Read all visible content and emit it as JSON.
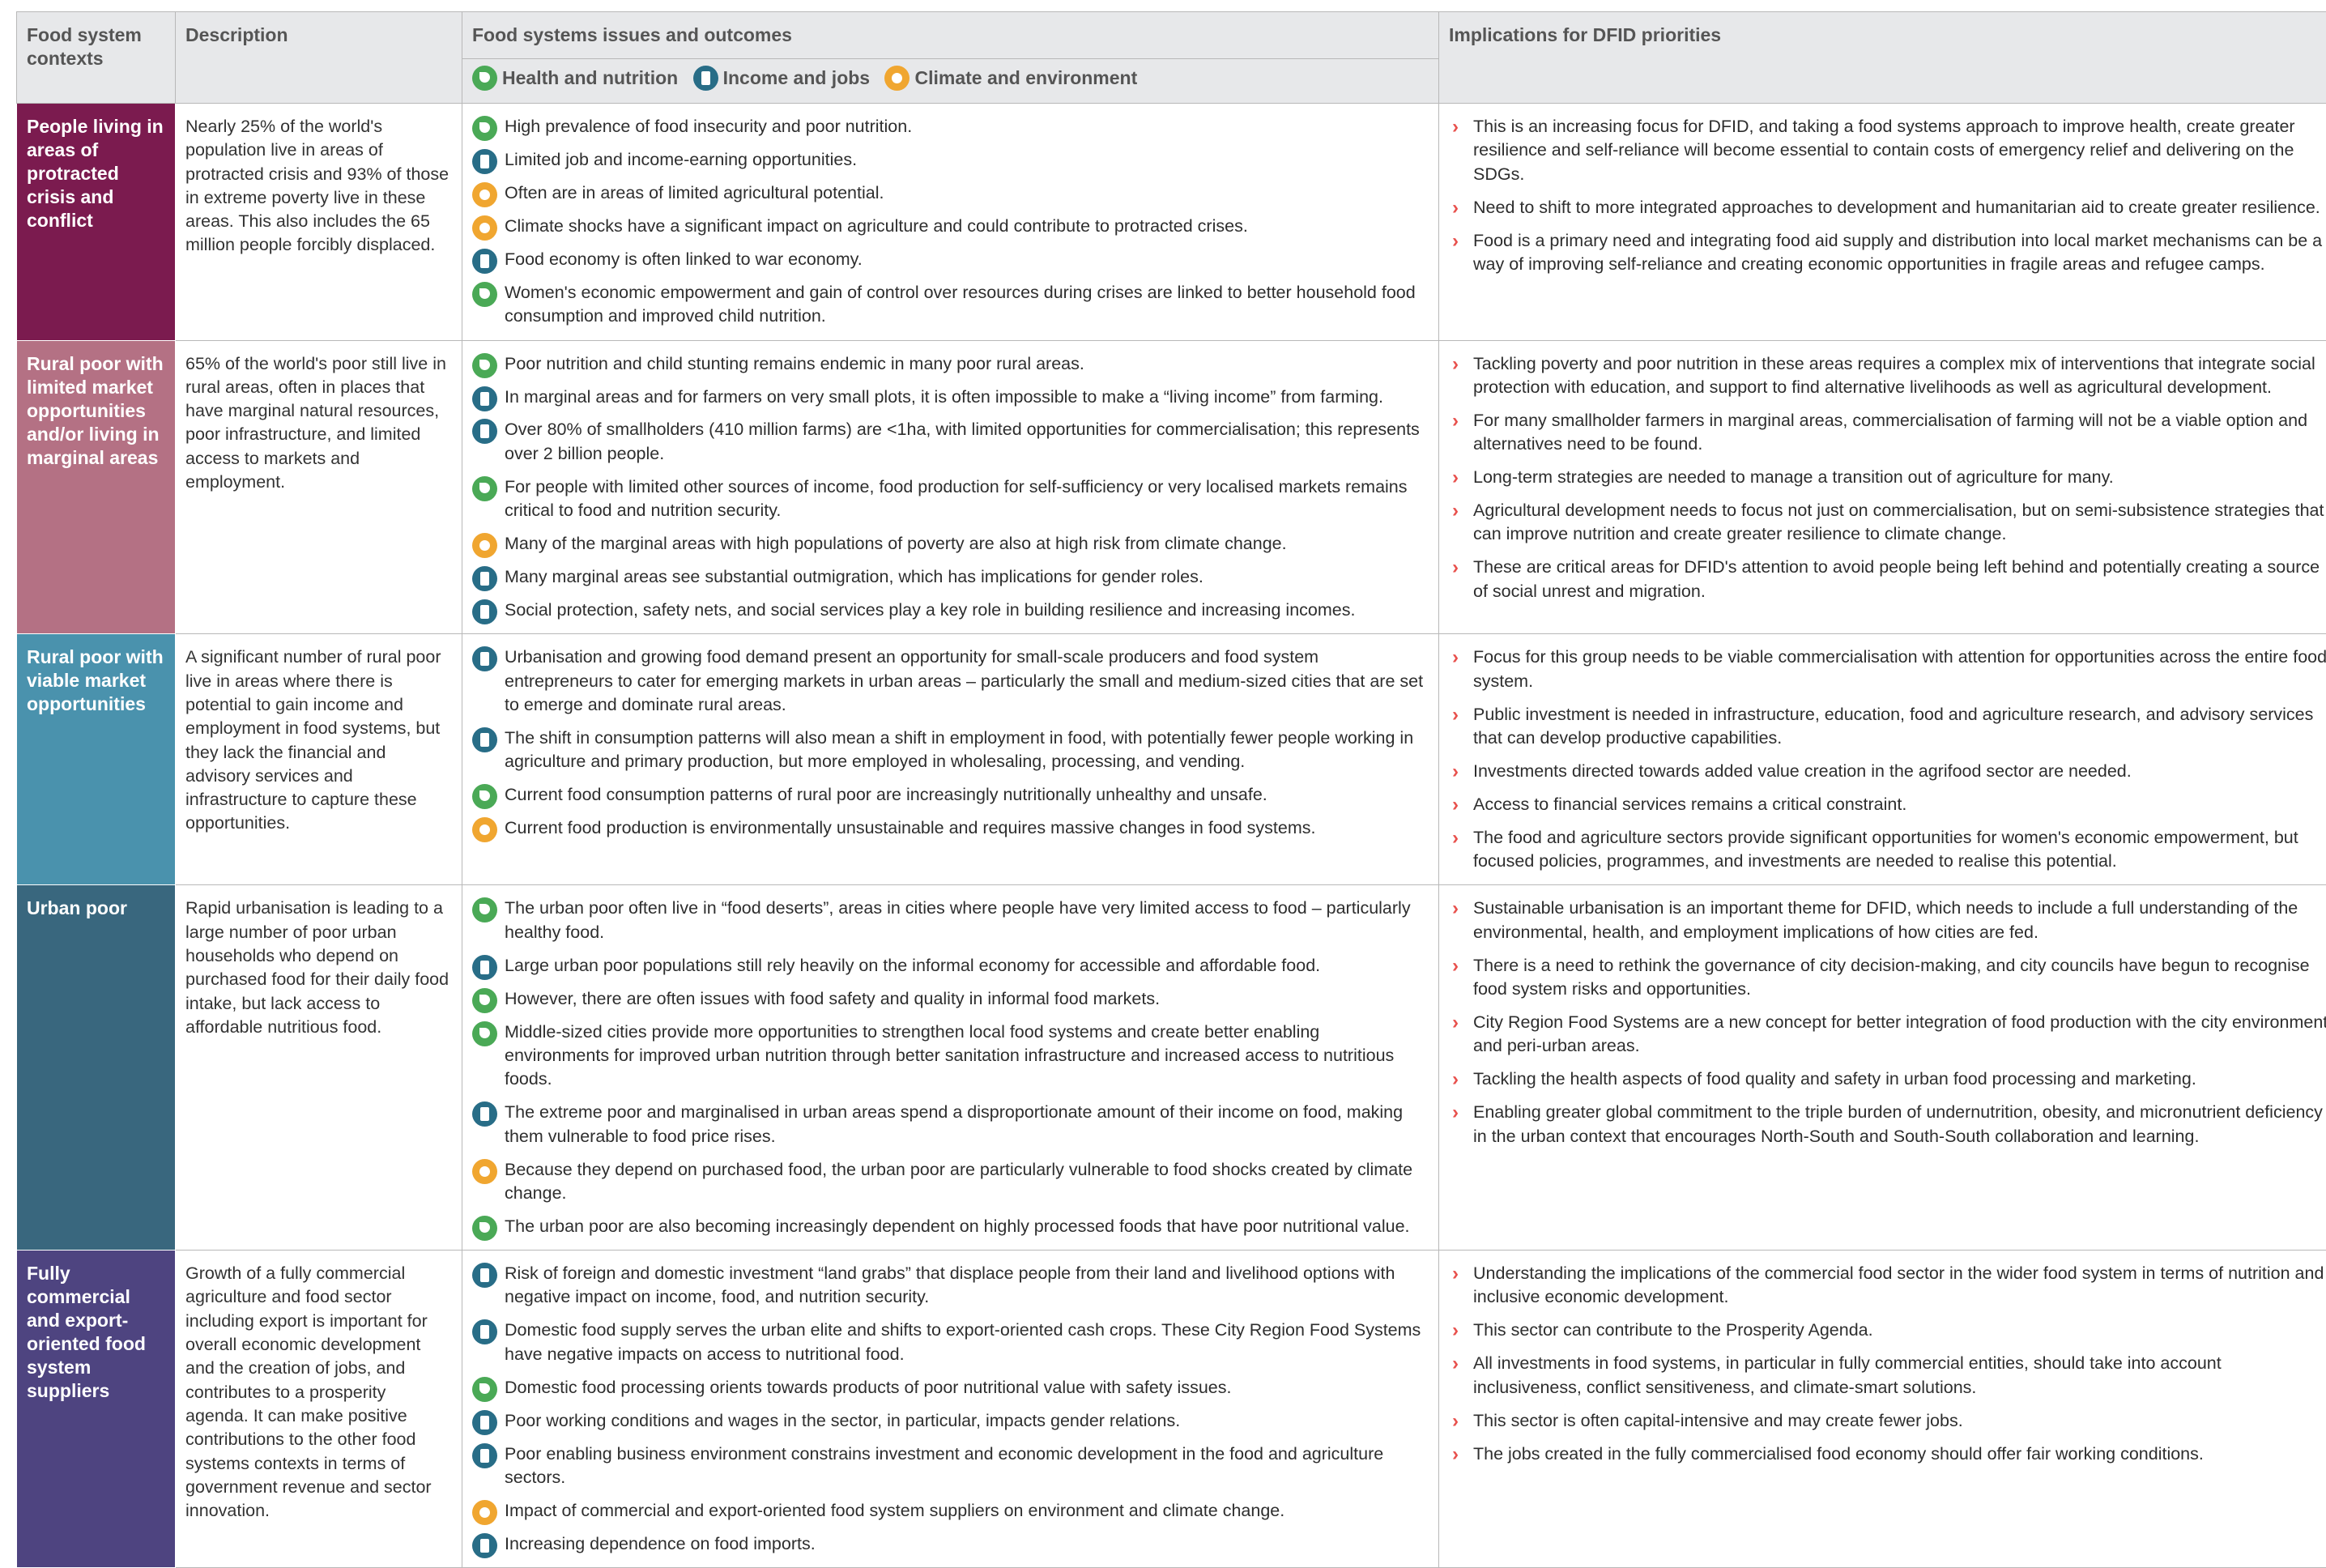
{
  "header": {
    "col1": "Food system contexts",
    "col2": "Description",
    "col3": "Food systems issues and outcomes",
    "col4": "Implications for DFID priorities",
    "legend": [
      {
        "icon": "health-icon",
        "label": "Health and nutrition"
      },
      {
        "icon": "income-icon",
        "label": "Income and jobs"
      },
      {
        "icon": "climate-icon",
        "label": "Climate and environment"
      }
    ]
  },
  "colors": {
    "health": "#4aa956",
    "income": "#286d87",
    "climate": "#f0a630",
    "chevron": "#e8514d",
    "row1": "#7b1b4f",
    "row2": "#b47184",
    "row3": "#4a92ad",
    "row4": "#39677e",
    "row5": "#4e4480"
  },
  "rows": [
    {
      "context": "People living in areas of protracted crisis and conflict",
      "description": "Nearly 25% of the world's population live in areas of protracted crisis and 93% of those in extreme poverty live in these areas. This also includes the 65 million people forcibly displaced.",
      "issues": [
        {
          "icon": "health",
          "text": "High prevalence of food insecurity and poor nutrition."
        },
        {
          "icon": "income",
          "text": "Limited job and income-earning opportunities."
        },
        {
          "icon": "climate",
          "text": "Often are in areas of limited agricultural potential."
        },
        {
          "icon": "climate",
          "text": "Climate shocks have a significant impact on agriculture and could contribute to protracted crises."
        },
        {
          "icon": "income",
          "text": "Food economy is often linked to war economy."
        },
        {
          "icon": "health",
          "text": "Women's economic empowerment and gain of control over resources during crises are linked to better household food consumption and improved child nutrition."
        }
      ],
      "implications": [
        "This is an increasing focus for DFID, and taking a food systems approach to improve health, create greater resilience and self-reliance will become essential to contain costs of emergency relief and delivering on the SDGs.",
        "Need to shift to more integrated approaches to development and humanitarian aid to create greater resilience.",
        "Food is a primary need and integrating food aid supply and distribution into local market mechanisms can be a way of improving self-reliance and creating economic opportunities in fragile areas and refugee camps."
      ]
    },
    {
      "context": "Rural poor with limited market opportunities and/or living in marginal areas",
      "description": "65% of the world's poor still live in rural areas, often in places that have marginal natural resources, poor infrastructure, and limited access to markets and employment.",
      "issues": [
        {
          "icon": "health",
          "text": "Poor nutrition and child stunting remains endemic in many poor rural areas."
        },
        {
          "icon": "income",
          "text": "In marginal areas and for farmers on very small plots, it is often impossible to make a “living income” from farming."
        },
        {
          "icon": "income",
          "text": "Over 80% of smallholders (410 million farms) are <1ha, with limited opportunities for commercialisation; this represents over 2 billion people."
        },
        {
          "icon": "health",
          "text": "For people with limited other sources of income, food production for self-sufficiency or very localised markets remains critical to food and nutrition security."
        },
        {
          "icon": "climate",
          "text": "Many of the marginal areas with high populations of poverty are also at high risk from climate change."
        },
        {
          "icon": "income",
          "text": "Many marginal areas see substantial outmigration, which has implications for gender roles."
        },
        {
          "icon": "income",
          "text": "Social protection, safety nets, and social services play a key role in building resilience and increasing incomes."
        }
      ],
      "implications": [
        "Tackling poverty and poor nutrition in these areas requires a complex mix of interventions that integrate social protection with education, and support to find alternative livelihoods as well as agricultural development.",
        "For many smallholder farmers in marginal areas, commercialisation of farming will not be a viable option and alternatives need to be found.",
        "Long-term strategies are needed to manage a transition out of agriculture for many.",
        "Agricultural development needs to focus not just on commercialisation, but on semi-subsistence strategies that can improve nutrition and create greater resilience to climate change.",
        "These are critical areas for DFID's attention to avoid people being left behind and potentially creating a source of social unrest and migration."
      ]
    },
    {
      "context": "Rural poor with viable market opportunities",
      "description": "A significant number of rural poor live in areas where there is potential to gain income and employment in food systems, but they lack the financial and advisory services and infrastructure to capture these opportunities.",
      "issues": [
        {
          "icon": "income",
          "text": "Urbanisation and growing food demand present an opportunity for small-scale producers and food system entrepreneurs to cater for emerging markets in urban areas – particularly the small and medium-sized cities that are set to emerge and dominate rural areas."
        },
        {
          "icon": "income",
          "text": "The shift in consumption patterns will also mean a shift in employment in food, with potentially fewer people working in agriculture and primary production, but more employed in wholesaling, processing, and vending."
        },
        {
          "icon": "health",
          "text": "Current food consumption patterns of rural poor are increasingly nutritionally unhealthy and unsafe."
        },
        {
          "icon": "climate",
          "text": "Current food production is environmentally unsustainable and requires massive changes in food systems."
        }
      ],
      "implications": [
        "Focus for this group needs to be viable commercialisation with attention for opportunities across the entire food system.",
        "Public investment is needed in infrastructure, education, food and agriculture research, and advisory services that can develop productive capabilities.",
        "Investments directed towards added value creation in the agrifood sector are needed.",
        "Access to financial services remains a critical constraint.",
        "The food and agriculture sectors provide significant opportunities for women's economic empowerment, but focused policies, programmes, and investments are needed to realise this potential."
      ]
    },
    {
      "context": "Urban poor",
      "description": "Rapid urbanisation is leading to a large number of poor urban households who depend on purchased food for their daily food intake, but lack access to affordable nutritious food.",
      "issues": [
        {
          "icon": "health",
          "text": "The urban poor often live in “food deserts”, areas in cities where people have very limited access to food – particularly healthy food."
        },
        {
          "icon": "income",
          "text": "Large urban poor populations still rely heavily on the informal economy for accessible and affordable food."
        },
        {
          "icon": "health",
          "text": "However, there are often issues with food safety and quality in informal food markets."
        },
        {
          "icon": "health",
          "text": "Middle-sized cities provide more opportunities to strengthen local food systems and create better enabling environments for improved urban nutrition through better sanitation infrastructure and increased access to nutritious foods."
        },
        {
          "icon": "income",
          "text": "The extreme poor and marginalised in urban areas spend a disproportionate amount of their income on food, making them vulnerable to food price rises."
        },
        {
          "icon": "climate",
          "text": "Because they depend on purchased food, the urban poor are particularly vulnerable to food shocks created by climate change."
        },
        {
          "icon": "health",
          "text": "The urban poor are also becoming increasingly dependent on highly processed foods that have poor nutritional value."
        }
      ],
      "implications": [
        "Sustainable urbanisation is an important theme for DFID, which needs to include a full understanding of the environmental, health, and employment implications of how cities are fed.",
        "There is a need to rethink the governance of city decision-making, and city councils have begun to recognise food system risks and opportunities.",
        "City Region Food Systems are a new concept for better integration of food production with the city environment and peri-urban areas.",
        "Tackling the health aspects of food quality and safety in urban food processing and marketing.",
        "Enabling greater global commitment to the triple burden of undernutrition, obesity, and micronutrient deficiency in the urban context that encourages North-South and South-South collaboration and learning."
      ]
    },
    {
      "context": "Fully commercial and export-oriented food system suppliers",
      "description": "Growth of a fully commercial agriculture and food sector including export is important for overall economic development and the creation of jobs, and contributes to a prosperity agenda. It can make positive contributions to the other food systems contexts in terms of government revenue and sector innovation.",
      "issues": [
        {
          "icon": "income",
          "text": "Risk of foreign and domestic investment “land grabs” that displace people from their land and livelihood options with negative impact on income, food, and nutrition security."
        },
        {
          "icon": "income",
          "text": "Domestic food supply serves the urban elite and shifts to export-oriented cash crops. These City Region Food Systems have negative impacts on access to nutritional food."
        },
        {
          "icon": "health",
          "text": "Domestic food processing orients towards products of poor nutritional value with safety issues."
        },
        {
          "icon": "income",
          "text": "Poor working conditions and wages in the sector, in particular, impacts gender relations."
        },
        {
          "icon": "income",
          "text": "Poor enabling business environment constrains investment and economic development in the food and agriculture sectors."
        },
        {
          "icon": "climate",
          "text": "Impact of commercial and export-oriented food system suppliers on environment and climate change."
        },
        {
          "icon": "income",
          "text": "Increasing dependence on food imports."
        }
      ],
      "implications": [
        "Understanding the implications of the commercial food sector in the wider food system in terms of nutrition and inclusive economic development.",
        "This sector can contribute to the Prosperity Agenda.",
        "All investments in food systems, in particular in fully commercial entities, should take into account inclusiveness, conflict sensitiveness, and climate-smart solutions.",
        "This sector is often capital-intensive and may create fewer jobs.",
        "The jobs created in the fully commercialised food economy should offer fair working conditions."
      ]
    }
  ]
}
